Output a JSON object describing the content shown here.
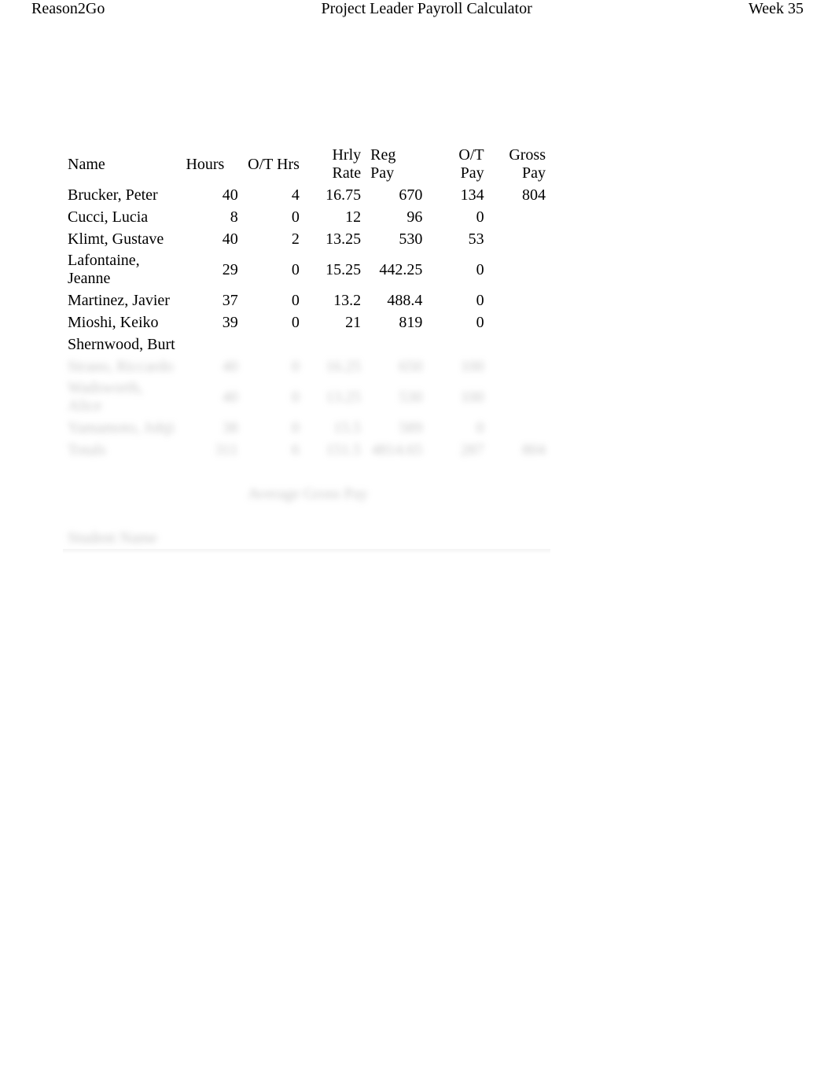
{
  "header": {
    "left": "Reason2Go",
    "center": "Project Leader Payroll Calculator",
    "right": "Week 35"
  },
  "columns": [
    "Name",
    "Hours",
    "O/T Hrs",
    "Hrly Rate",
    "Reg Pay",
    "O/T Pay",
    "Gross Pay"
  ],
  "rows": [
    {
      "name": "Brucker, Peter",
      "hours": "40",
      "ot_hrs": "4",
      "rate": "16.75",
      "reg": "670",
      "ot": "134",
      "gross": "804"
    },
    {
      "name": "Cucci, Lucia",
      "hours": "8",
      "ot_hrs": "0",
      "rate": "12",
      "reg": "96",
      "ot": "0",
      "gross": ""
    },
    {
      "name": "Klimt, Gustave",
      "hours": "40",
      "ot_hrs": "2",
      "rate": "13.25",
      "reg": "530",
      "ot": "53",
      "gross": ""
    },
    {
      "name": "Lafontaine, Jeanne",
      "hours": "29",
      "ot_hrs": "0",
      "rate": "15.25",
      "reg": "442.25",
      "ot": "0",
      "gross": ""
    },
    {
      "name": "Martinez, Javier",
      "hours": "37",
      "ot_hrs": "0",
      "rate": "13.2",
      "reg": "488.4",
      "ot": "0",
      "gross": ""
    },
    {
      "name": "Mioshi, Keiko",
      "hours": "39",
      "ot_hrs": "0",
      "rate": "21",
      "reg": "819",
      "ot": "0",
      "gross": ""
    },
    {
      "name": "Shernwood, Burt",
      "hours": "",
      "ot_hrs": "",
      "rate": "",
      "reg": "",
      "ot": "",
      "gross": ""
    }
  ],
  "blurred_rows": [
    {
      "name": "Strano, Riccardo",
      "hours": "40",
      "ot_hrs": "0",
      "rate": "16.25",
      "reg": "650",
      "ot": "100",
      "gross": ""
    },
    {
      "name": "Wadsworth, Alice",
      "hours": "40",
      "ot_hrs": "0",
      "rate": "13.25",
      "reg": "530",
      "ot": "100",
      "gross": ""
    },
    {
      "name": "Yamamoto, Johji",
      "hours": "38",
      "ot_hrs": "0",
      "rate": "15.5",
      "reg": "589",
      "ot": "0",
      "gross": ""
    }
  ],
  "totals": {
    "label": "Totals",
    "hours": "311",
    "ot_hrs": "6",
    "rate": "151.5",
    "reg": "4814.65",
    "ot": "287",
    "gross": "804"
  },
  "avg_label": "Average Gross Pay",
  "footer_label": "Student Name"
}
